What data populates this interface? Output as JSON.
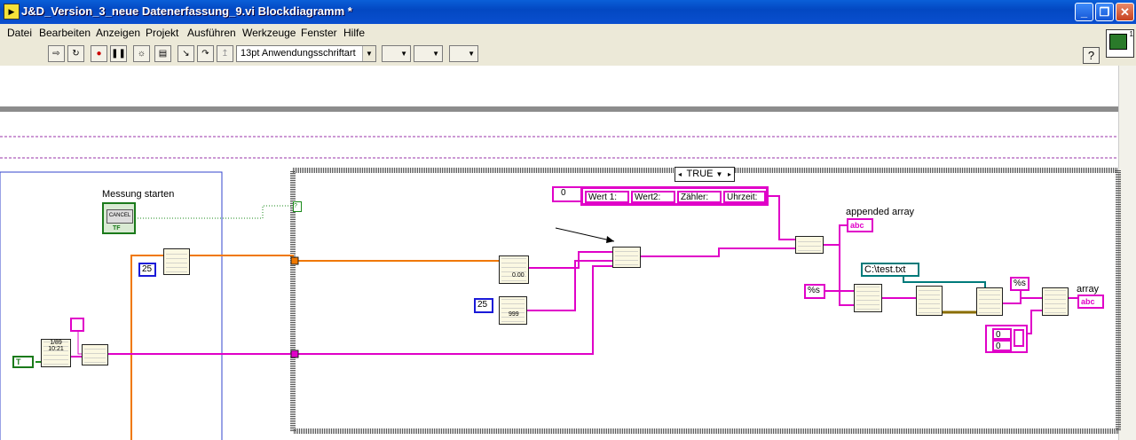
{
  "window": {
    "title": "J&D_Version_3_neue Datenerfassung_9.vi Blockdiagramm *"
  },
  "menu": [
    "Datei",
    "Bearbeiten",
    "Anzeigen",
    "Projekt",
    "Ausführen",
    "Werkzeuge",
    "Fenster",
    "Hilfe"
  ],
  "toolbar": {
    "font": "13pt Anwendungsschriftart",
    "help": "?"
  },
  "diagram": {
    "messung_label": "Messung starten",
    "cancel_button": "CANCEL",
    "tf": "TF",
    "case_selector": "TRUE",
    "const_25a": "25",
    "const_25b": "25",
    "const_zero": "0",
    "header_items": [
      "Wert 1:",
      "Wert2:",
      "Zähler:",
      "Uhrzeit:"
    ],
    "format_s_1": "%s",
    "format_s_2": "%s",
    "path_const": "C:\\test.txt",
    "appended_label": "appended array",
    "array_label": "array",
    "abc": "abc",
    "arr_zero_1": "0",
    "arr_zero_2": "0",
    "bool_true": "T",
    "node_time_top": "1/89",
    "node_time_bot": "10:21",
    "node_fmt": "0.00",
    "node_999": "999"
  }
}
